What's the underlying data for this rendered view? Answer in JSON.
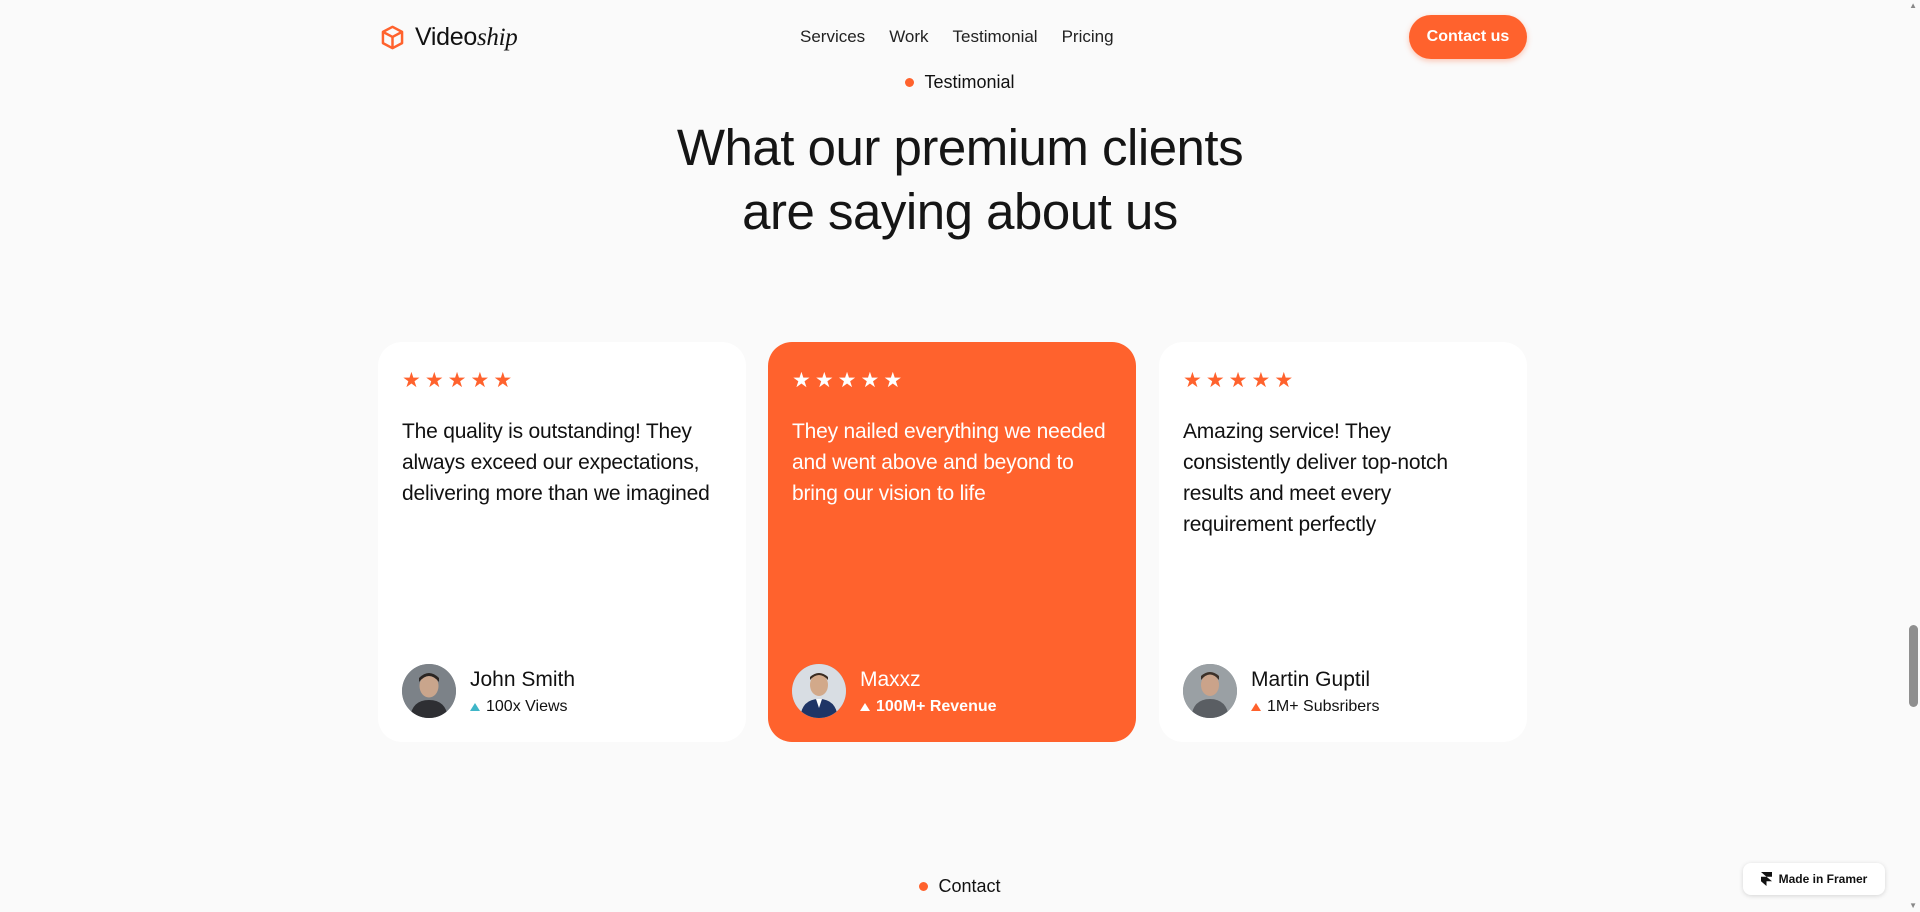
{
  "header": {
    "logo_prefix": "Video",
    "logo_suffix": "ship",
    "logo_icon": "cube-icon",
    "nav": [
      {
        "label": "Services"
      },
      {
        "label": "Work"
      },
      {
        "label": "Testimonial"
      },
      {
        "label": "Pricing"
      }
    ],
    "cta_label": "Contact us"
  },
  "colors": {
    "accent": "#ff622d",
    "background": "#fafafa",
    "card": "#ffffff",
    "metric_teal": "#3fb6c8"
  },
  "section": {
    "tag": "Testimonial",
    "headline_line1": "What our premium clients",
    "headline_line2": "are saying about us"
  },
  "testimonials": [
    {
      "rating": 5,
      "quote": "The quality is outstanding! They always exceed our expectations, delivering more than we imagined",
      "name": "John Smith",
      "metric": "100x Views",
      "metric_icon": "triangle-up-icon"
    },
    {
      "rating": 5,
      "quote": "They nailed everything we needed and went above and beyond to bring our vision to life",
      "name": "Maxxz",
      "metric": "100M+ Revenue",
      "metric_icon": "triangle-up-icon"
    },
    {
      "rating": 5,
      "quote": "Amazing service! They consistently deliver top-notch results and meet every requirement perfectly",
      "name": "Martin Guptil",
      "metric": "1M+ Subsribers",
      "metric_icon": "triangle-up-icon"
    }
  ],
  "next_section": {
    "tag": "Contact"
  },
  "badge": {
    "label": "Made in Framer",
    "icon": "framer-icon"
  },
  "scrollbar": {
    "position_fraction": 0.86
  }
}
